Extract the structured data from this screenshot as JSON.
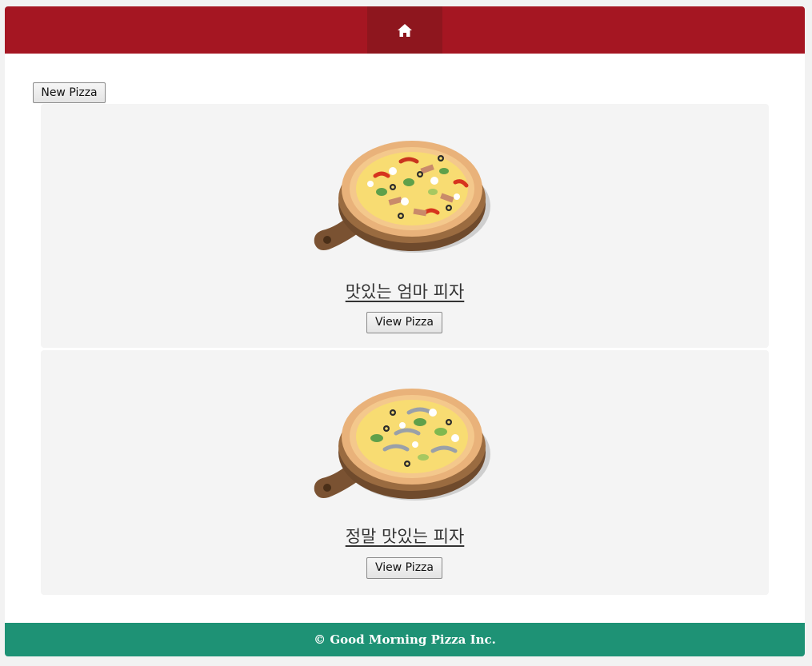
{
  "navbar": {
    "home_icon": "home-icon",
    "brand_color": "#a51622",
    "active_color": "#8e161e"
  },
  "toolbar": {
    "new_pizza_label": "New Pizza"
  },
  "pizzas": [
    {
      "name": "맛있는 엄마 피자",
      "view_label": "View Pizza",
      "image": "pizza-on-wooden-board-with-peppers-bacon-olives"
    },
    {
      "name": "정말 맛있는 피자",
      "view_label": "View Pizza",
      "image": "pizza-on-wooden-board-with-anchovies-greens-olives"
    }
  ],
  "footer": {
    "text": "© Good Morning Pizza Inc.",
    "color": "#1e9275"
  }
}
